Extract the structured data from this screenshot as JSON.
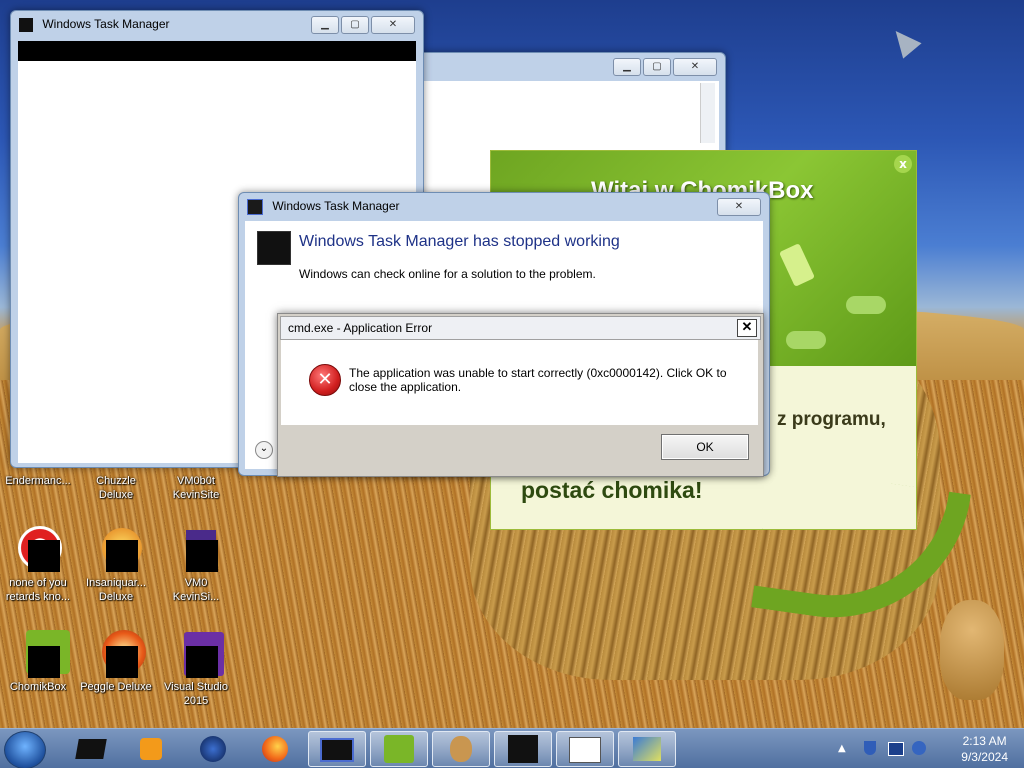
{
  "desktop_icons": [
    {
      "id": "endermanc",
      "label": "Endermanc...",
      "label2": ""
    },
    {
      "id": "chuzzle",
      "label": "Chuzzle",
      "label2": "Deluxe"
    },
    {
      "id": "vm0b0t",
      "label": "VM0b0t",
      "label2": "KevinSite"
    },
    {
      "id": "noneofyou",
      "label": "none of you",
      "label2": "retards kno..."
    },
    {
      "id": "insaniquarium",
      "label": "Insaniquar...",
      "label2": "Deluxe"
    },
    {
      "id": "vm0",
      "label": "VM0",
      "label2": "KevinSi..."
    },
    {
      "id": "chomikbox",
      "label": "ChomikBox",
      "label2": ""
    },
    {
      "id": "peggle",
      "label": "Peggle Deluxe",
      "label2": ""
    },
    {
      "id": "visualstudio",
      "label": "Visual Studio",
      "label2": "2015"
    }
  ],
  "taskmgr_window": {
    "title": "Windows Task Manager"
  },
  "chomikbox": {
    "title": "Witaj w ChomikBox",
    "close": "x",
    "text1": "z programu,",
    "text2": "postać chomika!"
  },
  "tm_stopped": {
    "title": "Windows Task Manager",
    "heading": "Windows Task Manager has stopped working",
    "subtext": "Windows can check online for a solution to the problem.",
    "close": "✕"
  },
  "error_dialog": {
    "title": "cmd.exe - Application Error",
    "message": "The application was unable to start correctly (0xc0000142). Click OK to close the application.",
    "ok_label": "OK",
    "close": "✕"
  },
  "taskbar": {
    "clock_time": "2:13 AM",
    "clock_date": "9/3/2024"
  },
  "colors": {
    "error_red": "#d11f1f",
    "heading_blue": "#1e3287",
    "chomik_green": "#7ab628"
  }
}
